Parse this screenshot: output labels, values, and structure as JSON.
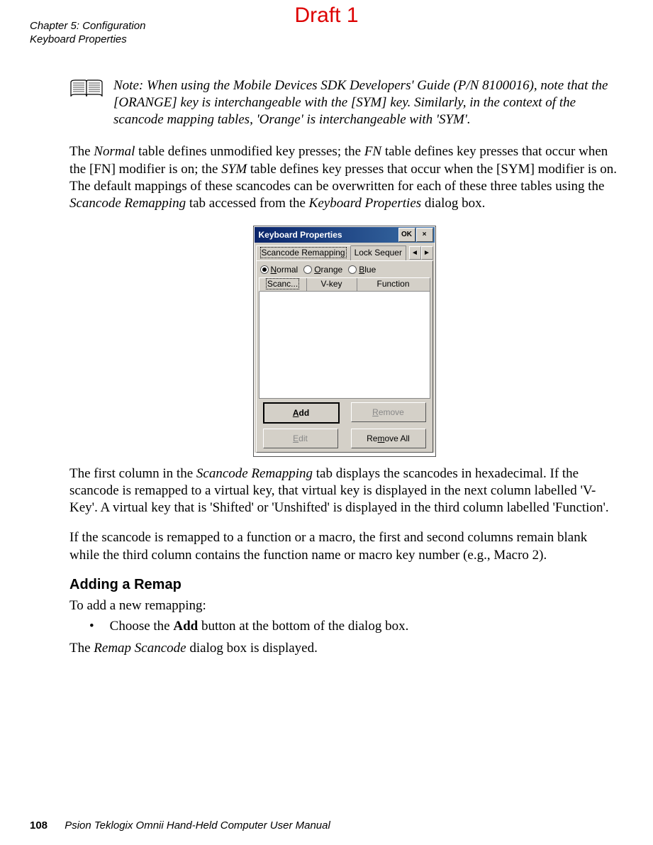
{
  "draft_label": "Draft 1",
  "header": {
    "chapter": "Chapter 5:  Configuration",
    "section": "Keyboard Properties"
  },
  "note": {
    "prefix": "Note:",
    "text": "When using the Mobile Devices SDK Developers' Guide (P/N 8100016), note that the [ORANGE] key is interchangeable with the [SYM] key. Similarly, in the context of the scancode mapping tables, 'Orange' is interchangeable with 'SYM'."
  },
  "para1_a": "The ",
  "para1_b": "Normal",
  "para1_c": " table defines unmodified key presses; the ",
  "para1_d": "FN",
  "para1_e": " table defines key presses that occur when the [FN] modifier is on; the ",
  "para1_f": "SYM",
  "para1_g": " table defines key presses that occur when the [SYM] modifier is on. The default mappings of these scancodes can be overwritten for each of these three tables using the ",
  "para1_h": "Scancode Remapping",
  "para1_i": " tab accessed from the ",
  "para1_j": "Keyboard Properties",
  "para1_k": " dialog box.",
  "dialog": {
    "title": "Keyboard Properties",
    "ok": "OK",
    "close": "×",
    "tab_active": "Scancode Remapping",
    "tab_inactive": "Lock Sequer",
    "scroll_left": "◄",
    "scroll_right": "►",
    "radio1_letter": "N",
    "radio1_rest": "ormal",
    "radio2_letter": "O",
    "radio2_rest": "range",
    "radio3_letter": "B",
    "radio3_rest": "lue",
    "col1": "Scanc...",
    "col2": "V-key",
    "col3": "Function",
    "btn_add_pre": "",
    "btn_add_u": "A",
    "btn_add_post": "dd",
    "btn_remove_pre": "",
    "btn_remove_u": "R",
    "btn_remove_post": "emove",
    "btn_edit_pre": "",
    "btn_edit_u": "E",
    "btn_edit_post": "dit",
    "btn_removeall_pre": "Re",
    "btn_removeall_u": "m",
    "btn_removeall_post": "ove All"
  },
  "para2_a": "The first column in the ",
  "para2_b": "Scancode Remapping",
  "para2_c": " tab displays the scancodes in hexadecimal. If the scancode is remapped to a virtual key, that virtual key is displayed in the next column labelled 'V-Key'. A virtual key that is 'Shifted' or 'Unshifted' is displayed in the third column labelled 'Function'.",
  "para3": "If the scancode is remapped to a function or a macro, the first and second columns remain blank while the third column contains the function name or macro key number (e.g., Macro 2).",
  "subheading": "Adding a Remap",
  "para4": "To add a new remapping:",
  "bullet_marker": "•",
  "bullet1_a": "Choose the ",
  "bullet1_b": "Add",
  "bullet1_c": " button at the bottom of the dialog box.",
  "para5_a": "The ",
  "para5_b": "Remap Scancode",
  "para5_c": " dialog box is displayed.",
  "footer": {
    "page": "108",
    "text": "Psion Teklogix Omnii Hand-Held Computer User Manual"
  }
}
